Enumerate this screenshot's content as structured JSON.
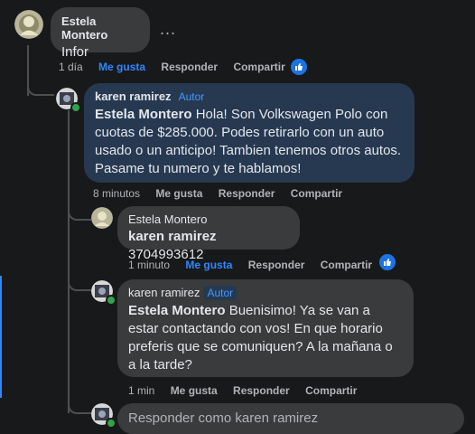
{
  "comment": {
    "author": "Estela Montero",
    "text": "Infor",
    "more": "...",
    "time": "1 día",
    "like": "Me gusta",
    "reply": "Responder",
    "share": "Compartir"
  },
  "replies": [
    {
      "author": "karen ramirez",
      "badge": "Autor",
      "mention": "Estela Montero",
      "text": " Hola! Son Volkswagen Polo con cuotas de $285.000. Podes retirarlo con un auto usado o un anticipo! Tambien tenemos otros autos. Pasame tu numero y te hablamos!",
      "time": "8 minutos",
      "like": "Me gusta",
      "reply": "Responder",
      "share": "Compartir"
    },
    {
      "author": "Estela Montero",
      "mention": "karen ramirez",
      "text": " 3704993612",
      "time": "1 minuto",
      "like": "Me gusta",
      "reply": "Responder",
      "share": "Compartir"
    },
    {
      "author": "karen ramirez",
      "badge": "Autor",
      "mention": "Estela Montero",
      "text": " Buenisimo! Ya se van a estar contactando con vos! En que horario preferis que se comuniquen? A la mañana o a la tarde?",
      "time": "1 min",
      "like": "Me gusta",
      "reply": "Responder",
      "share": "Compartir"
    }
  ],
  "reply_input": {
    "placeholder": "Responder como karen ramirez"
  },
  "colors": {
    "background": "#18191a",
    "bubble": "#3a3b3c",
    "highlight": "#263951",
    "accent": "#2d88ff",
    "online": "#31a24c"
  }
}
